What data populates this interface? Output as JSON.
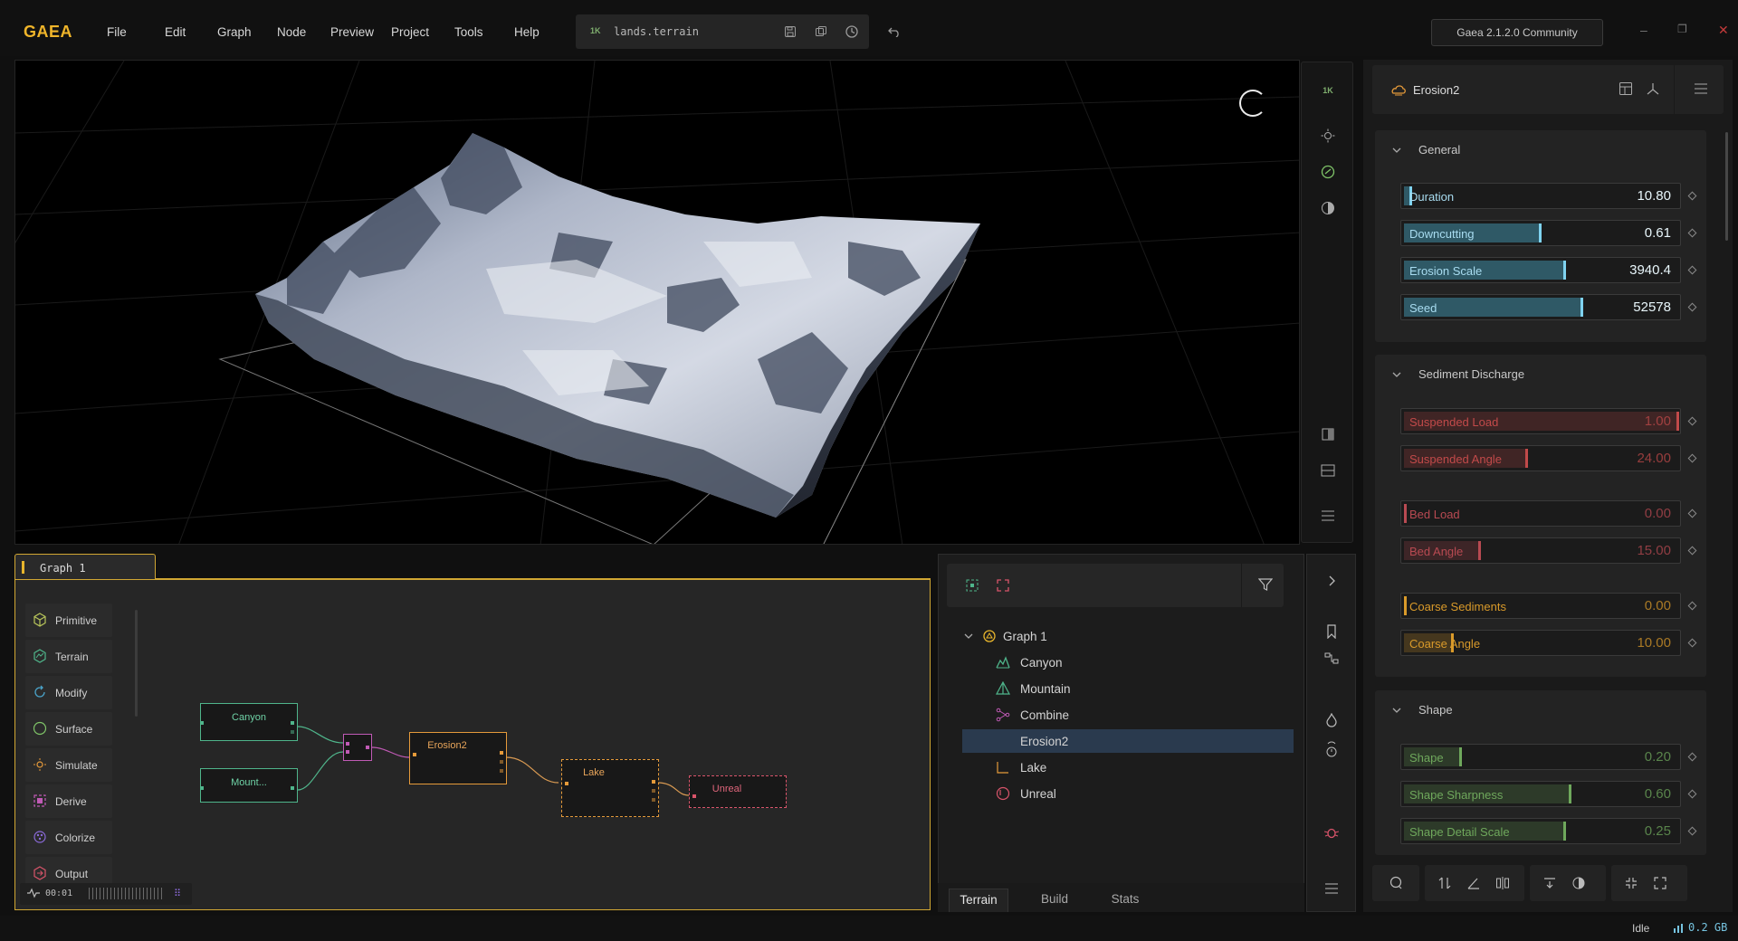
{
  "app": {
    "logo": "GAEA",
    "menu": [
      "File",
      "Edit",
      "Graph",
      "Node",
      "Preview",
      "Project",
      "Tools",
      "Help"
    ],
    "file_resolution": "1K",
    "file_name": "lands.terrain",
    "version": "Gaea 2.1.2.0 Community"
  },
  "viewport": {
    "toolbar_resolution": "1K"
  },
  "graph": {
    "tab_label": "Graph 1",
    "library": [
      {
        "label": "Primitive",
        "icon": "cube-icon",
        "color": "#b7c45a"
      },
      {
        "label": "Terrain",
        "icon": "terrain-icon",
        "color": "#4fb58b"
      },
      {
        "label": "Modify",
        "icon": "modify-icon",
        "color": "#4aa3c9"
      },
      {
        "label": "Surface",
        "icon": "surface-icon",
        "color": "#7fc468"
      },
      {
        "label": "Simulate",
        "icon": "simulate-icon",
        "color": "#e59a3a"
      },
      {
        "label": "Derive",
        "icon": "derive-icon",
        "color": "#c05ab5"
      },
      {
        "label": "Colorize",
        "icon": "colorize-icon",
        "color": "#8a6ad8"
      },
      {
        "label": "Output",
        "icon": "output-icon",
        "color": "#d8546a"
      }
    ],
    "nodes": {
      "canyon": "Canyon",
      "mountain": "Mount...",
      "erosion": "Erosion2",
      "lake": "Lake",
      "unreal": "Unreal"
    },
    "time": "00:01"
  },
  "tree": {
    "root": "Graph 1",
    "items": [
      {
        "label": "Canyon",
        "icon": "canyon-icon",
        "color": "#4fb58b"
      },
      {
        "label": "Mountain",
        "icon": "mountain-icon",
        "color": "#4fb58b"
      },
      {
        "label": "Combine",
        "icon": "combine-icon",
        "color": "#c05ab5"
      },
      {
        "label": "Erosion2",
        "icon": "erosion-icon",
        "color": "#e59a3a",
        "selected": true
      },
      {
        "label": "Lake",
        "icon": "lake-icon",
        "color": "#e59a3a"
      },
      {
        "label": "Unreal",
        "icon": "unreal-icon",
        "color": "#d8546a"
      }
    ],
    "tabs": [
      "Terrain",
      "Build",
      "Stats"
    ],
    "active_tab": "Terrain"
  },
  "properties": {
    "node_title": "Erosion2",
    "sections": {
      "general": "General",
      "sediment": "Sediment Discharge",
      "shape": "Shape"
    },
    "general": [
      {
        "name": "Duration",
        "value": "10.80",
        "level": 0.02
      },
      {
        "name": "Downcutting",
        "value": "0.61",
        "level": 0.49
      },
      {
        "name": "Erosion Scale",
        "value": "3940.4",
        "level": 0.58
      },
      {
        "name": "Seed",
        "value": "52578",
        "level": 0.64
      }
    ],
    "sediment": [
      {
        "name": "Suspended Load",
        "value": "1.00",
        "level": 1.0
      },
      {
        "name": "Suspended Angle",
        "value": "24.00",
        "level": 0.44
      },
      {
        "name": "Bed Load",
        "value": "0.00",
        "level": 0.0
      },
      {
        "name": "Bed Angle",
        "value": "15.00",
        "level": 0.27
      },
      {
        "name": "Coarse Sediments",
        "value": "0.00",
        "level": 0.0
      },
      {
        "name": "Coarse Angle",
        "value": "10.00",
        "level": 0.17
      }
    ],
    "shape": [
      {
        "name": "Shape",
        "value": "0.20",
        "level": 0.2
      },
      {
        "name": "Shape Sharpness",
        "value": "0.60",
        "level": 0.6
      },
      {
        "name": "Shape Detail Scale",
        "value": "0.25",
        "level": 0.58
      }
    ]
  },
  "status": {
    "state": "Idle",
    "memory": "0.2 GB"
  },
  "colors": {
    "accent": "#e8b52c",
    "general": "#4aa7c4",
    "suspended": "#c24a4a",
    "bed": "#b84a52",
    "coarse": "#d99a2a",
    "shape": "#6fa85c",
    "selection": "#2a3a4e"
  }
}
